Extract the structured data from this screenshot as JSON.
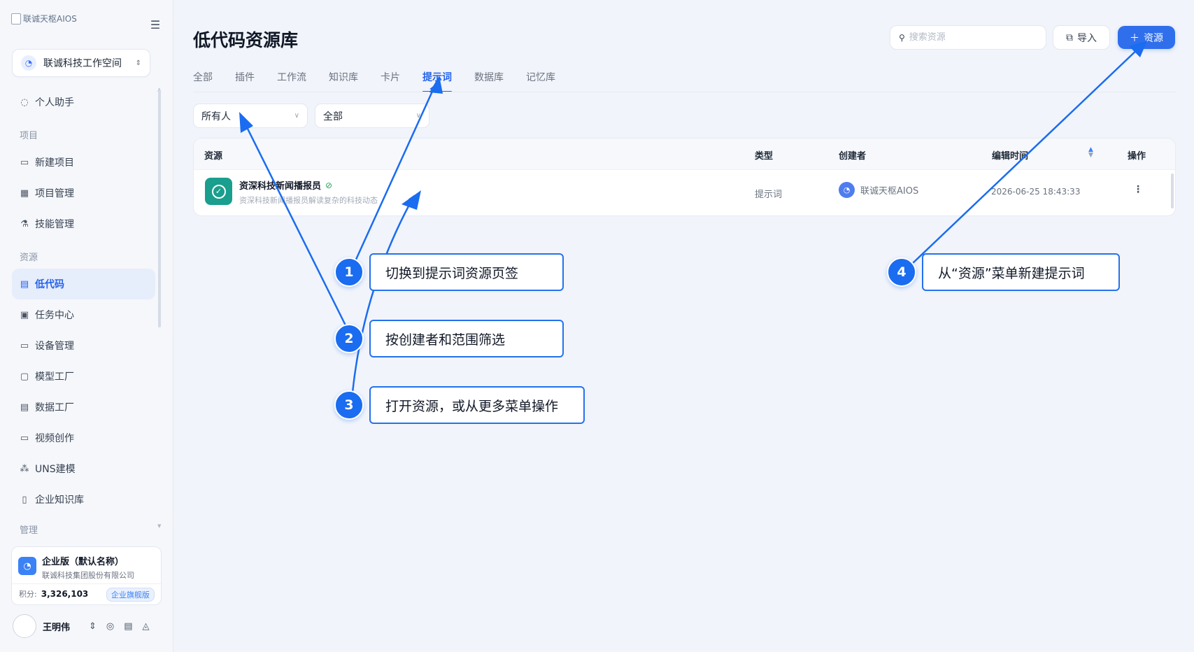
{
  "sidebar": {
    "logo_alt": "联诚天枢AIOS",
    "workspace": "联诚科技工作空间",
    "personal_assistant": "个人助手",
    "section_project": "项目",
    "new_project": "新建项目",
    "project_manage": "项目管理",
    "skill_manage": "技能管理",
    "section_resource": "资源",
    "low_code": "低代码",
    "task_center": "任务中心",
    "device_manage": "设备管理",
    "model_factory": "模型工厂",
    "data_factory": "数据工厂",
    "video_creation": "视频创作",
    "uns_modeling": "UNS建模",
    "enterprise_kb": "企业知识库",
    "section_manage": "管理"
  },
  "plan": {
    "name": "企业版（默认名称）",
    "company": "联诚科技集团股份有限公司",
    "points_label": "积分:",
    "points": "3,326,103",
    "badge": "企业旗舰版"
  },
  "user": {
    "name": "王明伟"
  },
  "page": {
    "title": "低代码资源库",
    "search_placeholder": "搜索资源",
    "import_label": "导入",
    "add_label": "资源"
  },
  "tabs": {
    "all": "全部",
    "plugin": "插件",
    "workflow": "工作流",
    "kb": "知识库",
    "card": "卡片",
    "prompt": "提示词",
    "database": "数据库",
    "memory": "记忆库"
  },
  "filters": {
    "owner": "所有人",
    "scope": "全部"
  },
  "table": {
    "headers": {
      "resource": "资源",
      "type": "类型",
      "creator": "创建者",
      "edit_time": "编辑时间",
      "ops": "操作"
    },
    "row": {
      "title": "资深科技新闻播报员",
      "desc": "资深科技新闻播报员解读复杂的科技动态",
      "type": "提示词",
      "creator": "联诚天枢AIOS",
      "time": "2026-06-25 18:43:33"
    }
  },
  "annotations": {
    "step1_num": "1",
    "step1": "切换到提示词资源页签",
    "step2_num": "2",
    "step2": "按创建者和范围筛选",
    "step3_num": "3",
    "step3": "打开资源，或从更多菜单操作",
    "step4_num": "4",
    "step4": "从“资源”菜单新建提示词"
  },
  "colors": {
    "accent": "#2f6fec",
    "annotation": "#1a6cf0",
    "resource_icon": "#1a9e8d"
  }
}
